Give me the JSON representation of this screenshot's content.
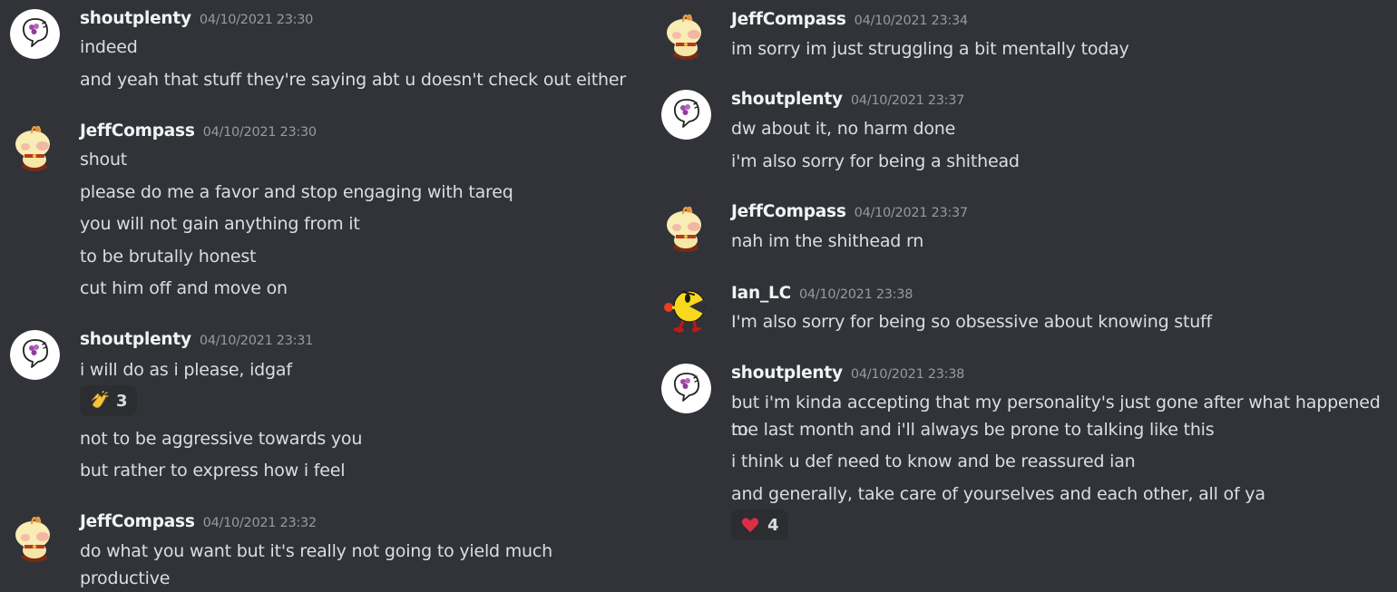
{
  "left": {
    "groups": [
      {
        "author": "shoutplenty",
        "timestamp": "04/10/2021 23:30",
        "lines": [
          "indeed",
          "and yeah that stuff they're saying abt u doesn't check out either"
        ]
      },
      {
        "author": "JeffCompass",
        "timestamp": "04/10/2021 23:30",
        "lines": [
          "shout",
          "please do me a favor and stop engaging with tareq",
          "you will not gain anything from it",
          "to be brutally honest",
          "cut him off and move on"
        ]
      },
      {
        "author": "shoutplenty",
        "timestamp": "04/10/2021 23:31",
        "lines": [
          "i will do as i please, idgaf",
          "not to be aggressive towards you",
          "but rather to express how i feel"
        ],
        "reaction": {
          "emoji": "clap-emoji",
          "count": "3"
        }
      },
      {
        "author": "JeffCompass",
        "timestamp": "04/10/2021 23:32",
        "lines": [
          "do what you want but it's really not going to yield much productive"
        ]
      }
    ]
  },
  "right": {
    "groups": [
      {
        "author": "JeffCompass",
        "timestamp": "04/10/2021 23:34",
        "lines": [
          "im sorry im just struggling a bit mentally today"
        ]
      },
      {
        "author": "shoutplenty",
        "timestamp": "04/10/2021 23:37",
        "lines": [
          "dw about it, no harm done",
          "i'm also sorry for being a shithead"
        ]
      },
      {
        "author": "JeffCompass",
        "timestamp": "04/10/2021 23:37",
        "lines": [
          "nah im the shithead rn"
        ]
      },
      {
        "author": "Ian_LC",
        "timestamp": "04/10/2021 23:38",
        "lines": [
          "I'm also sorry for being so obsessive about knowing stuff"
        ]
      },
      {
        "author": "shoutplenty",
        "timestamp": "04/10/2021 23:38",
        "lines": [
          "but i'm kinda accepting that my personality's just gone after what happened to",
          "me last month and i'll always be prone to talking like this",
          "i think u def need to know and be reassured ian",
          "and generally, take care of yourselves and each other, all of ya"
        ],
        "reaction": {
          "emoji": "red-heart-emoji",
          "count": "4"
        }
      }
    ]
  },
  "colors": {
    "background": "#313338",
    "text": "#dbdee1",
    "author": "#f2f3f5",
    "timestamp": "#949ba4",
    "reaction_bg": "#2b2d31"
  }
}
